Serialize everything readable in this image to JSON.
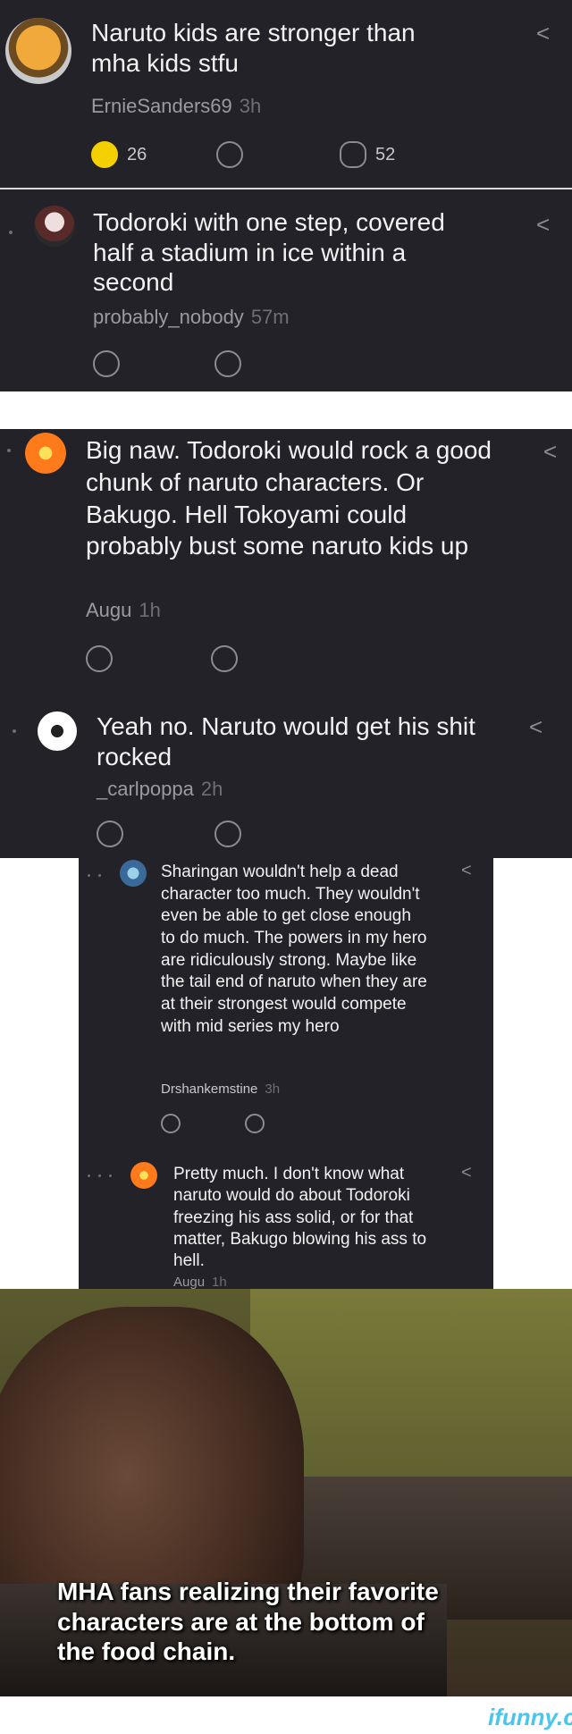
{
  "comments": [
    {
      "text": "Naruto kids are stronger than mha kids stfu",
      "author": "ErnieSanders69",
      "age": "3h"
    },
    {
      "text": "Todoroki with one step, covered half a stadium in ice within a second",
      "author": "probably_nobody",
      "age": "57m"
    },
    {
      "text": "Big naw. Todoroki would rock a good chunk of naruto characters. Or Bakugo. Hell Tokoyami could probably bust some naruto kids up",
      "author": "Augu",
      "age": "1h"
    },
    {
      "text": "Yeah no. Naruto would get his shit rocked",
      "author": "_carlpoppa",
      "age": "2h"
    },
    {
      "text": "Sharingan wouldn't help a dead character too much. They wouldn't even be able to get close enough to do much. The powers in my hero are ridiculously strong. Maybe like the tail end of naruto when they are at their strongest would compete with mid series my hero",
      "author": "Drshankemstine",
      "age": "3h"
    },
    {
      "text": "Pretty much. I don't know what naruto would do about Todoroki freezing his ass solid, or for that matter, Bakugo blowing his ass to hell.",
      "author": "Augu",
      "age": "1h"
    }
  ],
  "reactions": {
    "smile_count": "26",
    "reply_count": "52"
  },
  "meme": {
    "caption": "MHA fans realizing their favorite characters are at the bottom of the food chain."
  },
  "watermark": "ifunny.co",
  "icons": {
    "share": "share-icon",
    "smile": "smile-face-icon",
    "frown": "frown-face-icon",
    "reply": "reply-icon"
  },
  "colors": {
    "panel": "#222228",
    "accent_yellow": "#f5d000",
    "logo": "#48c6ee"
  }
}
